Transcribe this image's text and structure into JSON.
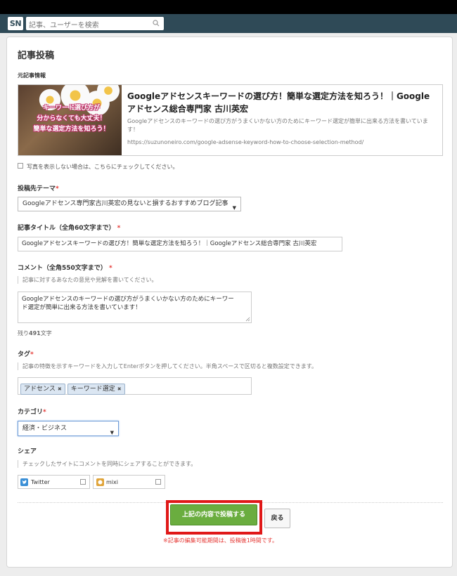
{
  "header": {
    "logo_text": "SN",
    "search_placeholder": "記事、ユーザーを検索"
  },
  "page": {
    "title": "記事投稿"
  },
  "source": {
    "label": "元記事情報",
    "thumb_text_1": "キーワード選び方が",
    "thumb_text_2": "分からなくても大丈夫！",
    "thumb_text_3": "簡単な選定方法を知ろう！",
    "title_line1": "Googleアドセンスキーワードの選び方！簡単な選定方法を知ろう！｜Google",
    "title_line2": "アドセンス総合専門家 古川英宏",
    "description": "Googleアドセンスのキーワードの選び方がうまくいかない方のためにキーワード選定が簡単に出来る方法を書いています！",
    "url": "https://suzunoneiro.com/google-adsense-keyword-how-to-choose-selection-method/"
  },
  "no_photo": {
    "label": "写真を表示しない場合は、こちらにチェックしてください。"
  },
  "theme": {
    "label": "投稿先テーマ",
    "required_mark": "*",
    "selected": "Googleアドセンス専門家古川英宏の見ないと損するおすすめブログ記事"
  },
  "article_title": {
    "label": "記事タイトル（全角60文字まで）",
    "required_mark": "*",
    "value": "Googleアドセンスキーワードの選び方！簡単な選定方法を知ろう！｜Googleアドセンス総合専門家 古川英宏"
  },
  "comment": {
    "label": "コメント（全角550文字まで）",
    "required_mark": "*",
    "hint": "記事に対するあなたの意見や見解を書いてください。",
    "value_line1": "Googleアドセンスのキーワードの選び方がうまくいかない方のためにキーワー",
    "value_line2": "ド選定が簡単に出来る方法を書いています！",
    "remaining_prefix": "残り",
    "remaining_count": "491",
    "remaining_suffix": "文字"
  },
  "tags": {
    "label": "タグ",
    "required_mark": "*",
    "hint": "記事の特徴を示すキーワードを入力してEnterボタンを押してください。半角スペースで区切ると複数設定できます。",
    "items": [
      "アドセンス",
      "キーワード選定"
    ],
    "remove_mark": "✖"
  },
  "category": {
    "label": "カテゴリ",
    "required_mark": "*",
    "selected": "経済・ビジネス"
  },
  "share": {
    "label": "シェア",
    "hint": "チェックしたサイトにコメントを同時にシェアすることができます。",
    "twitter": "Twitter",
    "mixi": "mixi"
  },
  "actions": {
    "submit": "上記の内容で投稿する",
    "back": "戻る",
    "note": "※記事の編集可能期間は、投稿後1時間です。"
  },
  "colors": {
    "header": "#2f4a57",
    "submit": "#6aad3f",
    "required": "#e53935",
    "highlight": "#e01818"
  }
}
